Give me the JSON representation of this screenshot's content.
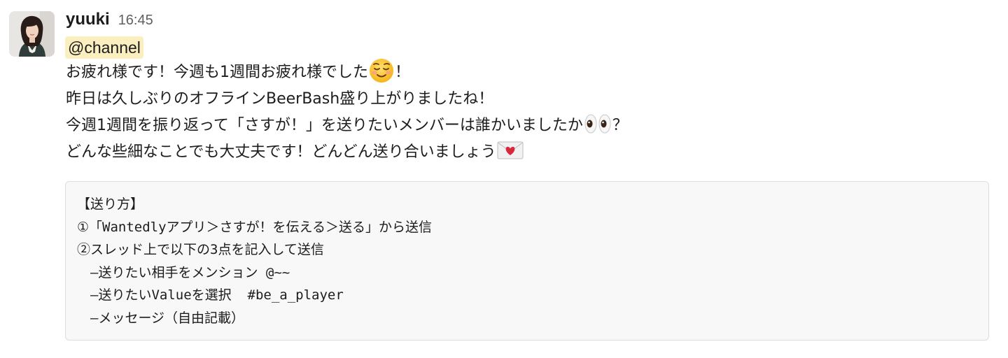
{
  "message": {
    "author": "yuuki",
    "time": "16:45",
    "mention": "@channel",
    "lines": [
      {
        "text": "お疲れ様です！今週も1週間お疲れ様でした",
        "emoji": "relieved-face-emoji",
        "tail": "！"
      },
      {
        "text": "昨日は久しぶりのオフラインBeerBash盛り上がりましたね！",
        "emoji": "",
        "tail": ""
      },
      {
        "text": "今週1週間を振り返って「さすが！」を送りたいメンバーは誰かいましたか",
        "emoji": "eyes-emoji",
        "tail": "？"
      },
      {
        "text": "どんな些細なことでも大丈夫です！どんどん送り合いましょう",
        "emoji": "love-letter-emoji",
        "tail": ""
      }
    ],
    "code_block": [
      "【送り方】",
      "①「Wantedlyアプリ＞さすが！を伝える＞送る」から送信",
      "②スレッド上で以下の3点を記入して送信",
      "　–送りたい相手をメンション @~~",
      "　–送りたいValueを選択  #be_a_player",
      "　–メッセージ（自由記載）"
    ]
  },
  "colors": {
    "mention_bg": "#fbeebf",
    "code_bg": "#f8f8f8",
    "code_border": "#dddddd",
    "text": "#1d1c1d",
    "timestamp": "#616061"
  }
}
